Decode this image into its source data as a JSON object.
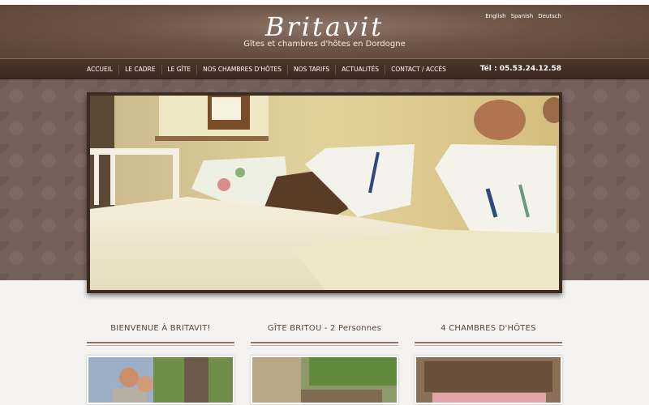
{
  "header": {
    "logo": "Britavit",
    "tagline": "Gîtes et chambres d'hôtes en Dordogne",
    "languages": [
      "English",
      "Spanish",
      "Deutsch"
    ]
  },
  "nav": {
    "items": [
      "ACCUEIL",
      "LE CADRE",
      "LE GÎTE",
      "NOS CHAMBRES D'HÔTES",
      "NOS TARIFS",
      "ACTUALITÉS",
      "CONTACT / ACCÈS"
    ],
    "phone": "Tél : 05.53.24.12.58"
  },
  "columns": [
    {
      "title": "BIENVENUE À BRITAVIT!"
    },
    {
      "title": "GÎTE BRITOU - 2 Personnes"
    },
    {
      "title": "4 CHAMBRES D'HÔTES"
    }
  ],
  "colors": {
    "header": "#6e5446",
    "nav": "#3f2c23",
    "damask": "#75615a",
    "heading": "#5a4438"
  }
}
